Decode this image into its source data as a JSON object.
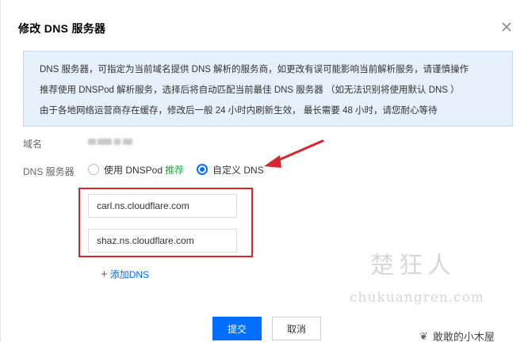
{
  "dialog": {
    "title": "修改 DNS 服务器"
  },
  "notice": {
    "lines": [
      "DNS 服务器，可指定为当前域名提供 DNS 解析的服务商，如更改有误可能影响当前解析服务，请谨慎操作",
      "推荐使用 DNSPod 解析服务，选择后将自动匹配当前最佳 DNS 服务器 （如无法识别将使用默认 DNS ）",
      "由于各地网络运营商存在缓存，修改后一般 24 小时内刷新生效， 最长需要 48 小时，请您耐心等待"
    ]
  },
  "form": {
    "domain_label": "域名",
    "dns_label": "DNS 服务器",
    "option_dnspod": "使用 DNSPod",
    "option_recommend": "推荐",
    "option_custom": "自定义 DNS",
    "selected_option": "custom",
    "nameservers": [
      "carl.ns.cloudflare.com",
      "shaz.ns.cloudflare.com"
    ],
    "add_dns": "添加DNS"
  },
  "buttons": {
    "submit": "提交",
    "cancel": "取消"
  },
  "watermark": {
    "cn": "楚狂人",
    "en": "chukuangren.com"
  },
  "account": {
    "name": "敢敢的小木屋"
  },
  "colors": {
    "primary": "#006eff",
    "notice_bg": "#e5f0fb",
    "recommend": "#29a744",
    "annotation_red": "#d7262b"
  }
}
